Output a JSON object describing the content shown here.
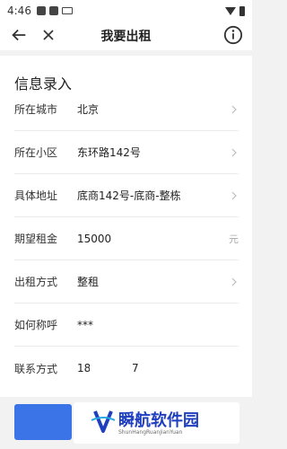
{
  "status": {
    "time": "4:46"
  },
  "nav": {
    "title": "我要出租",
    "icons": {
      "back": "arrow-left-icon",
      "close": "close-icon",
      "info": "info-icon"
    }
  },
  "form": {
    "section_title": "信息录入",
    "rows": [
      {
        "label": "所在城市",
        "value": "北京",
        "suffix": "chevron-right-icon"
      },
      {
        "label": "所在小区",
        "value": "东环路142号",
        "suffix": "chevron-right-icon"
      },
      {
        "label": "具体地址",
        "value": "底商142号-底商-整栋",
        "suffix": "chevron-right-icon"
      },
      {
        "label": "期望租金",
        "value": "15000",
        "suffix_text": "元"
      },
      {
        "label": "出租方式",
        "value": "整租",
        "suffix": "chevron-right-icon"
      },
      {
        "label": "如何称呼",
        "value": "***"
      },
      {
        "label": "联系方式",
        "value": "181          7"
      }
    ]
  },
  "watermark": {
    "title": "瞬航软件园",
    "subtitle": "ShunHangRuanJianYuan"
  },
  "colors": {
    "accent": "#3b74e6",
    "background": "#f2f2f2"
  }
}
